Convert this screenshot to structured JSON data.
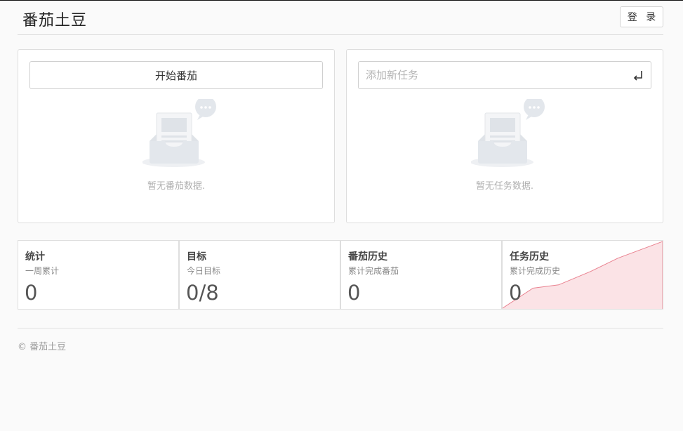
{
  "header": {
    "brand": "番茄土豆",
    "login_label": "登 录"
  },
  "pomodoro_panel": {
    "start_button": "开始番茄",
    "empty_text": "暂无番茄数据."
  },
  "task_panel": {
    "input_placeholder": "添加新任务",
    "input_value": "",
    "enter_icon": "enter-icon",
    "empty_text": "暂无任务数据."
  },
  "stats": [
    {
      "title": "统计",
      "subtitle": "一周累计",
      "value": "0"
    },
    {
      "title": "目标",
      "subtitle": "今日目标",
      "value": "0/8"
    },
    {
      "title": "番茄历史",
      "subtitle": "累计完成番茄",
      "value": "0"
    },
    {
      "title": "任务历史",
      "subtitle": "累计完成历史",
      "value": "0"
    }
  ],
  "task_history_sparkline": {
    "type": "area",
    "values": [
      0,
      0.3,
      0.35,
      0.55,
      0.75,
      1.0
    ],
    "color": "#e9818f",
    "fill": "#fbe3e6"
  },
  "footer": {
    "copyright": "© 番茄土豆"
  }
}
